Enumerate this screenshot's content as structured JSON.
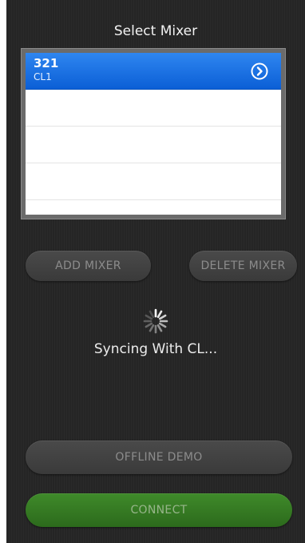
{
  "header": {
    "title": "Select Mixer"
  },
  "mixers": [
    {
      "name": "321",
      "model": "CL1",
      "selected": true,
      "detail_icon": "chevron-circle-right-icon"
    },
    {
      "name": "",
      "model": "",
      "selected": false
    },
    {
      "name": "",
      "model": "",
      "selected": false
    },
    {
      "name": "",
      "model": "",
      "selected": false
    }
  ],
  "buttons": {
    "add": "ADD MIXER",
    "delete": "DELETE MIXER",
    "offline": "OFFLINE DEMO",
    "connect": "CONNECT"
  },
  "status": {
    "text": "Syncing With CL...",
    "icon": "loading-spinner-icon"
  },
  "colors": {
    "selection": "#1a6fe3",
    "connect": "#357a24",
    "background": "#262626"
  }
}
